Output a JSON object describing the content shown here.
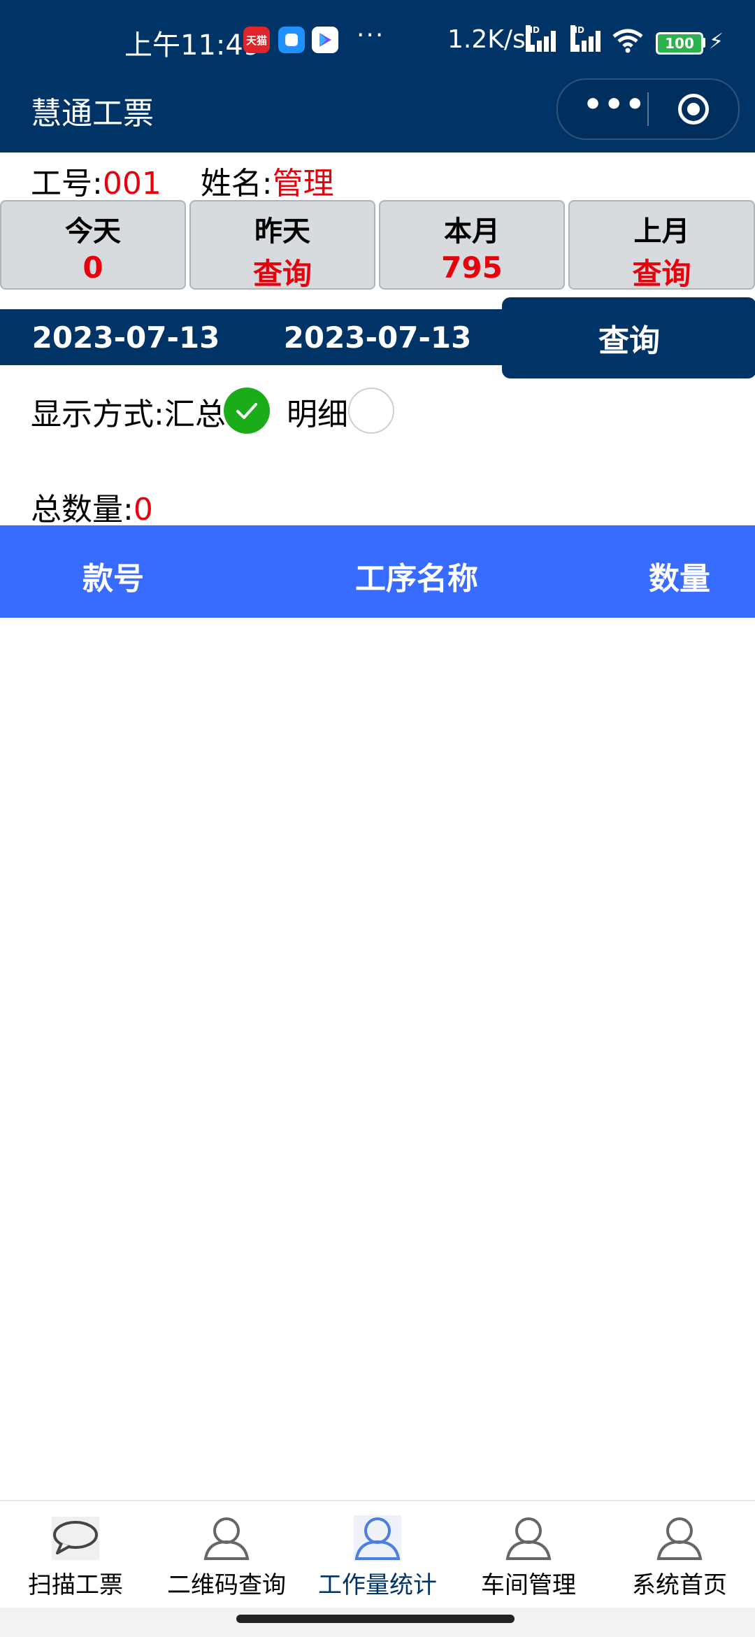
{
  "status_bar": {
    "time": "上午11:49",
    "app_badge": "天猫",
    "more": "···",
    "speed": "1.2K/s",
    "hd1": "HD",
    "hd2": "HD",
    "battery": "100"
  },
  "header": {
    "title": "慧通工票",
    "menu_dots": "•••"
  },
  "employee": {
    "id_label": "工号:",
    "id_value": "001",
    "name_label": "姓名:",
    "name_value": "管理"
  },
  "stats": [
    {
      "label": "今天",
      "value": "0"
    },
    {
      "label": "昨天",
      "value": "查询"
    },
    {
      "label": "本月",
      "value": "795"
    },
    {
      "label": "上月",
      "value": "查询"
    }
  ],
  "date_range": {
    "start": "2023-07-13",
    "end": "2023-07-13",
    "query_label": "查询"
  },
  "display_mode": {
    "label": "显示方式:",
    "summary_label": "汇总",
    "detail_label": "明细",
    "selected": "汇总"
  },
  "total": {
    "label": "总数量:",
    "value": "0"
  },
  "table": {
    "columns": [
      "款号",
      "工序名称",
      "数量"
    ],
    "rows": []
  },
  "nav": {
    "items": [
      {
        "label": "扫描工票",
        "icon": "chat-bubble-icon"
      },
      {
        "label": "二维码查询",
        "icon": "person-icon"
      },
      {
        "label": "工作量统计",
        "icon": "person-icon",
        "active": true
      },
      {
        "label": "车间管理",
        "icon": "person-icon"
      },
      {
        "label": "系统首页",
        "icon": "person-icon"
      }
    ]
  },
  "colors": {
    "primary": "#003366",
    "table_header": "#386bff",
    "accent_red": "#e8000b",
    "radio_checked": "#1aad19"
  }
}
